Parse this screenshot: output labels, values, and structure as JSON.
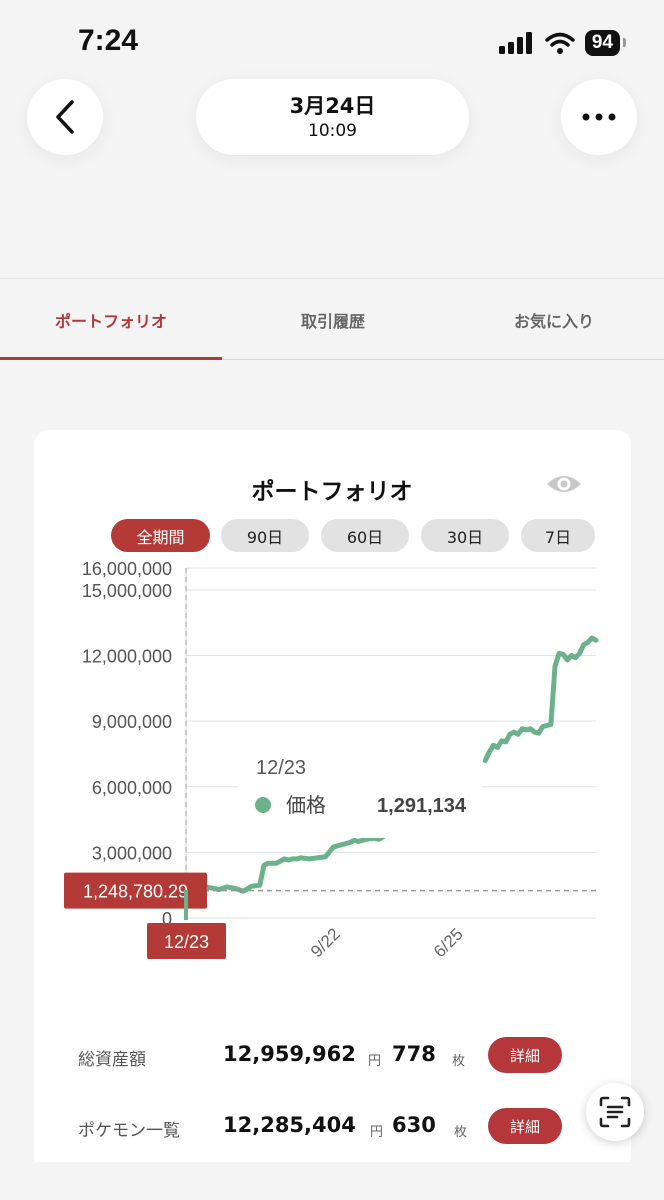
{
  "status_bar": {
    "time": "7:24",
    "battery": "94"
  },
  "header": {
    "date": "3月24日",
    "time": "10:09"
  },
  "tabs": [
    {
      "label": "ポートフォリオ",
      "active": true
    },
    {
      "label": "取引履歴",
      "active": false
    },
    {
      "label": "お気に入り",
      "active": false
    }
  ],
  "card": {
    "title": "ポートフォリオ",
    "ranges": [
      {
        "label": "全期間",
        "active": true
      },
      {
        "label": "90日",
        "active": false
      },
      {
        "label": "60日",
        "active": false
      },
      {
        "label": "30日",
        "active": false
      },
      {
        "label": "7日",
        "active": false
      }
    ]
  },
  "chart_data": {
    "type": "line",
    "x_tick_labels": [
      "12/23",
      "9/22",
      "6/25"
    ],
    "y_ticks": [
      0,
      3000000,
      6000000,
      9000000,
      12000000,
      15000000,
      16000000
    ],
    "y_tick_labels": [
      "0",
      "3,000,000",
      "6,000,000",
      "9,000,000",
      "12,000,000",
      "15,000,000",
      "16,000,000"
    ],
    "ylim": [
      0,
      16000000
    ],
    "xlim": [
      0,
      100
    ],
    "grid": true,
    "series": [
      {
        "color": "#6bb28b",
        "x": [
          0,
          1,
          2,
          4,
          6,
          8,
          10,
          12,
          14,
          16,
          18,
          19,
          20,
          22,
          24,
          25,
          26,
          27,
          28,
          30,
          32,
          34,
          36,
          38,
          40,
          41,
          42,
          44,
          46,
          47,
          48
        ],
        "y": [
          1291134,
          1350000,
          1500000,
          1450000,
          1380000,
          1300000,
          1420000,
          1350000,
          1220000,
          1450000,
          1500000,
          2400000,
          2500000,
          2500000,
          2700000,
          2650000,
          2700000,
          2700000,
          2750000,
          2700000,
          2750000,
          2800000,
          3250000,
          3350000,
          3450000,
          3550000,
          3500000,
          3600000,
          3650000,
          3600000,
          3700000
        ]
      },
      {
        "color": "#6bb28b",
        "x": [
          73,
          74,
          75,
          76,
          77,
          78,
          79,
          80,
          81,
          82,
          83,
          84,
          85,
          86,
          87,
          88,
          89,
          90,
          91,
          92,
          93,
          94,
          95,
          96,
          97,
          98,
          99,
          100
        ],
        "y": [
          7200000,
          7600000,
          7900000,
          7800000,
          8100000,
          8050000,
          8400000,
          8500000,
          8400000,
          8650000,
          8600000,
          8650000,
          8500000,
          8450000,
          8750000,
          8800000,
          8850000,
          11500000,
          12100000,
          12050000,
          11800000,
          12000000,
          11900000,
          12100000,
          12500000,
          12600000,
          12800000,
          12700000
        ]
      }
    ],
    "crosshair": {
      "x_label": "12/23",
      "y_label": "1,248,780.29",
      "y": 1248780.29
    },
    "tooltip": {
      "date": "12/23",
      "series_label": "価格",
      "value": "1,291,134"
    }
  },
  "stats": [
    {
      "label": "総資産額",
      "value": "12,959,962",
      "unit": "円",
      "count": "778",
      "count_unit": "枚",
      "button": "詳細"
    },
    {
      "label": "ポケモン一覧",
      "value": "12,285,404",
      "unit": "円",
      "count": "630",
      "count_unit": "枚",
      "button": "詳細"
    }
  ],
  "icons": {
    "back": "chevron-left-icon",
    "more": "more-dots-icon",
    "eye": "eye-icon",
    "scan": "text-scan-icon"
  },
  "colors": {
    "accent": "#b5373a",
    "line": "#6bb28b"
  }
}
